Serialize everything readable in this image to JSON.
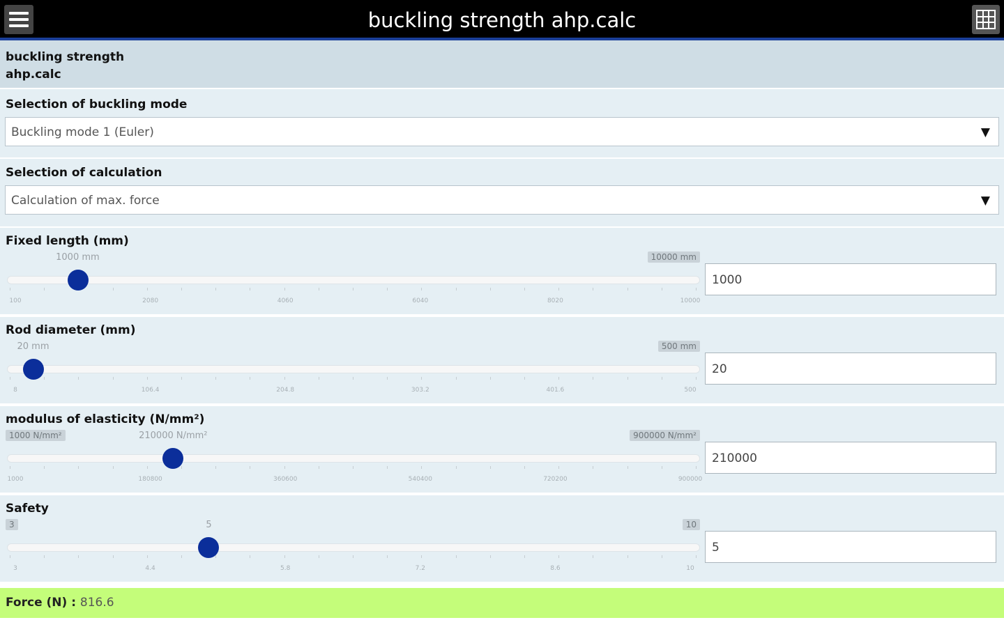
{
  "app": {
    "title": "buckling strength ahp.calc",
    "menu_icon": "hamburger-menu-icon",
    "grid_icon": "grid-view-icon"
  },
  "header": {
    "line1": "buckling strength",
    "line2": "ahp.calc"
  },
  "buckling_mode": {
    "label": "Selection of buckling mode",
    "value": "Buckling mode 1 (Euler)"
  },
  "calculation": {
    "label": "Selection of calculation",
    "value": "Calculation of max. force"
  },
  "sliders": [
    {
      "label": "Fixed length (mm)",
      "min": 100,
      "max": 10000,
      "value": 1000,
      "value_bubble": "1000 mm",
      "min_bubble": "",
      "max_bubble": "10000 mm",
      "tick_labels": [
        "100",
        "2080",
        "4060",
        "6040",
        "8020",
        "10000"
      ],
      "input_value": "1000"
    },
    {
      "label": "Rod diameter (mm)",
      "min": 8,
      "max": 500,
      "value": 20,
      "value_bubble": "20 mm",
      "min_bubble": "",
      "max_bubble": "500 mm",
      "tick_labels": [
        "8",
        "106.4",
        "204.8",
        "303.2",
        "401.6",
        "500"
      ],
      "input_value": "20"
    },
    {
      "label": "modulus of elasticity (N/mm²)",
      "min": 1000,
      "max": 900000,
      "value": 210000,
      "value_bubble": "210000 N/mm²",
      "min_bubble": "1000 N/mm²",
      "max_bubble": "900000 N/mm²",
      "tick_labels": [
        "1000",
        "180800",
        "360600",
        "540400",
        "720200",
        "900000"
      ],
      "input_value": "210000"
    },
    {
      "label": "Safety",
      "min": 3,
      "max": 10,
      "value": 5,
      "value_bubble": "5",
      "min_bubble": "3",
      "max_bubble": "10",
      "tick_labels": [
        "3",
        "4.4",
        "5.8",
        "7.2",
        "8.6",
        "10"
      ],
      "input_value": "5"
    }
  ],
  "result": {
    "label": "Force (N) :",
    "value": "816.6"
  },
  "colors": {
    "thumb": "#0b2e9a",
    "result_bg": "#c4fd7a",
    "topbar_border": "#1b3f99"
  }
}
